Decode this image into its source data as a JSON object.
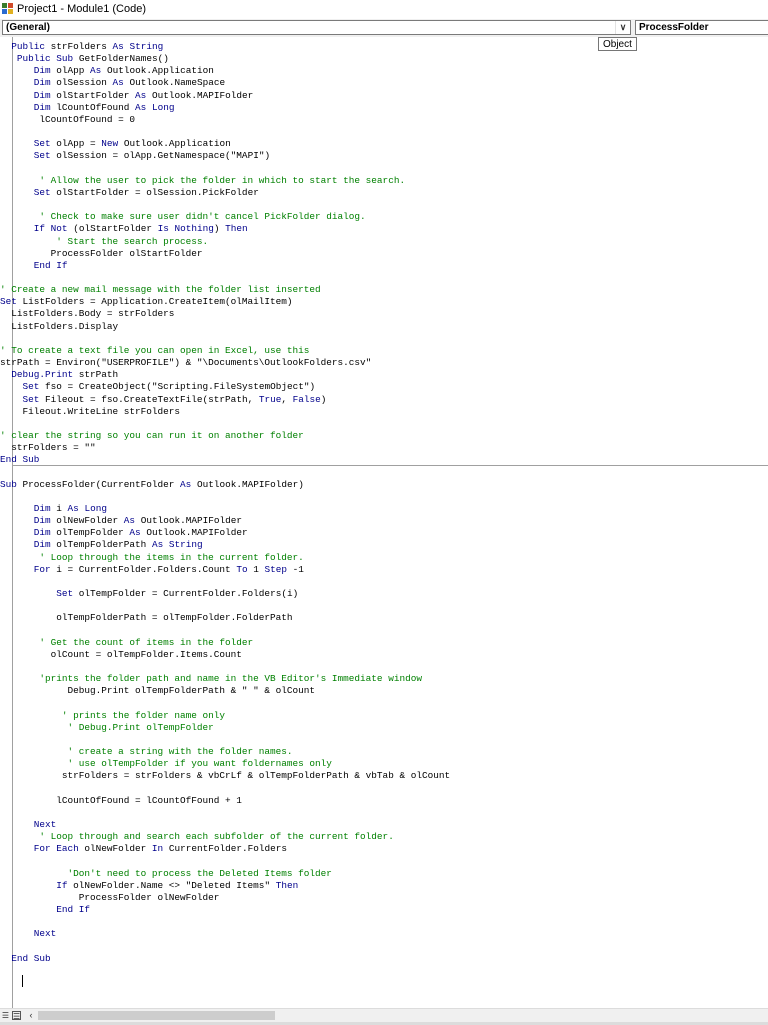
{
  "window": {
    "title": "Project1 - Module1 (Code)"
  },
  "toolbar": {
    "object_combo": "(General)",
    "procedure_combo": "ProcessFolder",
    "tooltip": "Object"
  },
  "icons": {
    "app": "vba-project-icon",
    "dropdown": "chevron-down-icon",
    "procedure_view": "procedure-view-icon",
    "full_module_view": "full-module-view-icon",
    "scroll_left": "arrow-left-icon"
  },
  "colors": {
    "keyword": "#00008b",
    "comment": "#008000",
    "text": "#000000"
  },
  "code_lines": [
    [
      [
        "  ",
        "t"
      ],
      [
        "Public",
        "k"
      ],
      [
        " strFolders ",
        "t"
      ],
      [
        "As",
        "k"
      ],
      [
        " ",
        "t"
      ],
      [
        "String",
        "k"
      ]
    ],
    [
      [
        "   ",
        "t"
      ],
      [
        "Public",
        "k"
      ],
      [
        " ",
        "t"
      ],
      [
        "Sub",
        "k"
      ],
      [
        " GetFolderNames()",
        "t"
      ]
    ],
    [
      [
        "      ",
        "t"
      ],
      [
        "Dim",
        "k"
      ],
      [
        " olApp ",
        "t"
      ],
      [
        "As",
        "k"
      ],
      [
        " Outlook.Application",
        "t"
      ]
    ],
    [
      [
        "      ",
        "t"
      ],
      [
        "Dim",
        "k"
      ],
      [
        " olSession ",
        "t"
      ],
      [
        "As",
        "k"
      ],
      [
        " Outlook.NameSpace",
        "t"
      ]
    ],
    [
      [
        "      ",
        "t"
      ],
      [
        "Dim",
        "k"
      ],
      [
        " olStartFolder ",
        "t"
      ],
      [
        "As",
        "k"
      ],
      [
        " Outlook.MAPIFolder",
        "t"
      ]
    ],
    [
      [
        "      ",
        "t"
      ],
      [
        "Dim",
        "k"
      ],
      [
        " lCountOfFound ",
        "t"
      ],
      [
        "As",
        "k"
      ],
      [
        " ",
        "t"
      ],
      [
        "Long",
        "k"
      ]
    ],
    [
      [
        "       lCountOfFound = 0",
        "t"
      ]
    ],
    [
      [
        "",
        "t"
      ]
    ],
    [
      [
        "      ",
        "t"
      ],
      [
        "Set",
        "k"
      ],
      [
        " olApp = ",
        "t"
      ],
      [
        "New",
        "k"
      ],
      [
        " Outlook.Application",
        "t"
      ]
    ],
    [
      [
        "      ",
        "t"
      ],
      [
        "Set",
        "k"
      ],
      [
        " olSession = olApp.GetNamespace(\"MAPI\")",
        "t"
      ]
    ],
    [
      [
        "",
        "t"
      ]
    ],
    [
      [
        "       ' Allow the user to pick the folder in which to start the search.",
        "c"
      ]
    ],
    [
      [
        "      ",
        "t"
      ],
      [
        "Set",
        "k"
      ],
      [
        " olStartFolder = olSession.PickFolder",
        "t"
      ]
    ],
    [
      [
        "",
        "t"
      ]
    ],
    [
      [
        "       ' Check to make sure user didn't cancel PickFolder dialog.",
        "c"
      ]
    ],
    [
      [
        "      ",
        "t"
      ],
      [
        "If",
        "k"
      ],
      [
        " ",
        "t"
      ],
      [
        "Not",
        "k"
      ],
      [
        " (olStartFolder ",
        "t"
      ],
      [
        "Is",
        "k"
      ],
      [
        " ",
        "t"
      ],
      [
        "Nothing",
        "k"
      ],
      [
        ") ",
        "t"
      ],
      [
        "Then",
        "k"
      ]
    ],
    [
      [
        "          ' Start the search process.",
        "c"
      ]
    ],
    [
      [
        "         ProcessFolder olStartFolder",
        "t"
      ]
    ],
    [
      [
        "      ",
        "t"
      ],
      [
        "End If",
        "k"
      ]
    ],
    [
      [
        "",
        "t"
      ]
    ],
    [
      [
        "' Create a new mail message with the folder list inserted",
        "c"
      ]
    ],
    [
      [
        "Set",
        "k"
      ],
      [
        " ListFolders = Application.CreateItem(olMailItem)",
        "t"
      ]
    ],
    [
      [
        "  ListFolders.Body = strFolders",
        "t"
      ]
    ],
    [
      [
        "  ListFolders.Display",
        "t"
      ]
    ],
    [
      [
        "",
        "t"
      ]
    ],
    [
      [
        "' To create a text file you can open in Excel, use this",
        "c"
      ]
    ],
    [
      [
        "strPath = Environ(\"USERPROFILE\") & \"\\Documents\\OutlookFolders.csv\"",
        "t"
      ]
    ],
    [
      [
        "  ",
        "t"
      ],
      [
        "Debug.Print",
        "k"
      ],
      [
        " strPath",
        "t"
      ]
    ],
    [
      [
        "    ",
        "t"
      ],
      [
        "Set",
        "k"
      ],
      [
        " fso = CreateObject(\"Scripting.FileSystemObject\")",
        "t"
      ]
    ],
    [
      [
        "    ",
        "t"
      ],
      [
        "Set",
        "k"
      ],
      [
        " Fileout = fso.CreateTextFile(strPath, ",
        "t"
      ],
      [
        "True",
        "k"
      ],
      [
        ", ",
        "t"
      ],
      [
        "False",
        "k"
      ],
      [
        ")",
        "t"
      ]
    ],
    [
      [
        "    Fileout.WriteLine strFolders",
        "t"
      ]
    ],
    [
      [
        "",
        "t"
      ]
    ],
    [
      [
        "' clear the string so you can run it on another folder",
        "c"
      ]
    ],
    [
      [
        "  strFolders = \"\"",
        "t"
      ]
    ],
    [
      [
        "End Sub",
        "k"
      ]
    ],
    [
      [
        "",
        "t"
      ]
    ],
    [
      [
        "Sub",
        "k"
      ],
      [
        " ProcessFolder(CurrentFolder ",
        "t"
      ],
      [
        "As",
        "k"
      ],
      [
        " Outlook.MAPIFolder)",
        "t"
      ]
    ],
    [
      [
        "",
        "t"
      ]
    ],
    [
      [
        "      ",
        "t"
      ],
      [
        "Dim",
        "k"
      ],
      [
        " i ",
        "t"
      ],
      [
        "As",
        "k"
      ],
      [
        " ",
        "t"
      ],
      [
        "Long",
        "k"
      ]
    ],
    [
      [
        "      ",
        "t"
      ],
      [
        "Dim",
        "k"
      ],
      [
        " olNewFolder ",
        "t"
      ],
      [
        "As",
        "k"
      ],
      [
        " Outlook.MAPIFolder",
        "t"
      ]
    ],
    [
      [
        "      ",
        "t"
      ],
      [
        "Dim",
        "k"
      ],
      [
        " olTempFolder ",
        "t"
      ],
      [
        "As",
        "k"
      ],
      [
        " Outlook.MAPIFolder",
        "t"
      ]
    ],
    [
      [
        "      ",
        "t"
      ],
      [
        "Dim",
        "k"
      ],
      [
        " olTempFolderPath ",
        "t"
      ],
      [
        "As",
        "k"
      ],
      [
        " ",
        "t"
      ],
      [
        "String",
        "k"
      ]
    ],
    [
      [
        "       ' Loop through the items in the current folder.",
        "c"
      ]
    ],
    [
      [
        "      ",
        "t"
      ],
      [
        "For",
        "k"
      ],
      [
        " i = CurrentFolder.Folders.Count ",
        "t"
      ],
      [
        "To",
        "k"
      ],
      [
        " 1 ",
        "t"
      ],
      [
        "Step",
        "k"
      ],
      [
        " -1",
        "t"
      ]
    ],
    [
      [
        "",
        "t"
      ]
    ],
    [
      [
        "          ",
        "t"
      ],
      [
        "Set",
        "k"
      ],
      [
        " olTempFolder = CurrentFolder.Folders(i)",
        "t"
      ]
    ],
    [
      [
        "",
        "t"
      ]
    ],
    [
      [
        "          olTempFolderPath = olTempFolder.FolderPath",
        "t"
      ]
    ],
    [
      [
        "",
        "t"
      ]
    ],
    [
      [
        "       ' Get the count of items in the folder",
        "c"
      ]
    ],
    [
      [
        "         olCount = olTempFolder.Items.Count",
        "t"
      ]
    ],
    [
      [
        "",
        "t"
      ]
    ],
    [
      [
        "       'prints the folder path and name in the VB Editor's Immediate window",
        "c"
      ]
    ],
    [
      [
        "            Debug.Print olTempFolderPath & \" \" & olCount",
        "t"
      ]
    ],
    [
      [
        "",
        "t"
      ]
    ],
    [
      [
        "           ' prints the folder name only",
        "c"
      ]
    ],
    [
      [
        "            ' Debug.Print olTempFolder",
        "c"
      ]
    ],
    [
      [
        "",
        "t"
      ]
    ],
    [
      [
        "            ' create a string with the folder names.",
        "c"
      ]
    ],
    [
      [
        "            ' use olTempFolder if you want foldernames only",
        "c"
      ]
    ],
    [
      [
        "           strFolders = strFolders & vbCrLf & olTempFolderPath & vbTab & olCount",
        "t"
      ]
    ],
    [
      [
        "",
        "t"
      ]
    ],
    [
      [
        "          lCountOfFound = lCountOfFound + 1",
        "t"
      ]
    ],
    [
      [
        "",
        "t"
      ]
    ],
    [
      [
        "      ",
        "t"
      ],
      [
        "Next",
        "k"
      ]
    ],
    [
      [
        "       ' Loop through and search each subfolder of the current folder.",
        "c"
      ]
    ],
    [
      [
        "      ",
        "t"
      ],
      [
        "For Each",
        "k"
      ],
      [
        " olNewFolder ",
        "t"
      ],
      [
        "In",
        "k"
      ],
      [
        " CurrentFolder.Folders",
        "t"
      ]
    ],
    [
      [
        "",
        "t"
      ]
    ],
    [
      [
        "            'Don't need to process the Deleted Items folder",
        "c"
      ]
    ],
    [
      [
        "          ",
        "t"
      ],
      [
        "If",
        "k"
      ],
      [
        " olNewFolder.Name <> \"Deleted Items\" ",
        "t"
      ],
      [
        "Then",
        "k"
      ]
    ],
    [
      [
        "              ProcessFolder olNewFolder",
        "t"
      ]
    ],
    [
      [
        "          ",
        "t"
      ],
      [
        "End If",
        "k"
      ]
    ],
    [
      [
        "",
        "t"
      ]
    ],
    [
      [
        "      ",
        "t"
      ],
      [
        "Next",
        "k"
      ]
    ],
    [
      [
        "",
        "t"
      ]
    ],
    [
      [
        "  ",
        "t"
      ],
      [
        "End Sub",
        "k"
      ]
    ]
  ]
}
